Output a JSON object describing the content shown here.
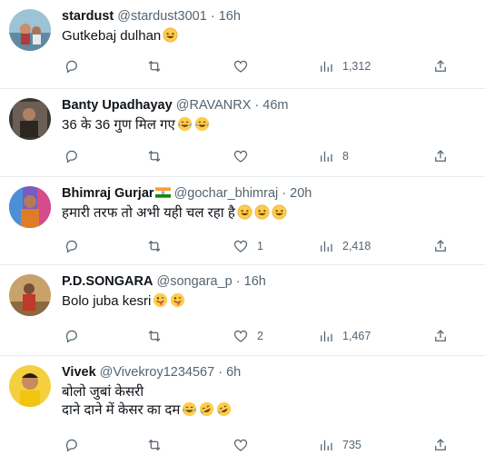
{
  "tweets": [
    {
      "name": "stardust",
      "handle": "@stardust3001",
      "sep": "·",
      "time": "16h",
      "lines": [
        "Gutkebaj dulhan"
      ],
      "replies": "",
      "retweets": "",
      "likes": "",
      "views": "1,312"
    },
    {
      "name": "Banty Upadhayay",
      "handle": "@RAVANRX",
      "sep": "·",
      "time": "46m",
      "lines": [
        "36 के 36 गुण मिल गए"
      ],
      "replies": "",
      "retweets": "",
      "likes": "",
      "views": "8"
    },
    {
      "name": "Bhimraj Gurjar",
      "handle": "@gochar_bhimraj",
      "sep": "·",
      "time": "20h",
      "lines": [
        "हमारी तरफ तो अभी यही चल रहा है"
      ],
      "replies": "",
      "retweets": "",
      "likes": "1",
      "views": "2,418"
    },
    {
      "name": "P.D.SONGARA",
      "handle": "@songara_p",
      "sep": "·",
      "time": "16h",
      "lines": [
        "Bolo juba kesri"
      ],
      "replies": "",
      "retweets": "",
      "likes": "2",
      "views": "1,467"
    },
    {
      "name": "Vivek",
      "handle": "@Vivekroy1234567",
      "sep": "·",
      "time": "6h",
      "lines": [
        "बोलो जुबां केसरी",
        "दाने दाने में केसर का दम"
      ],
      "replies": "",
      "retweets": "",
      "likes": "",
      "views": "735"
    }
  ],
  "icons": {
    "reply": "reply-icon",
    "retweet": "retweet-icon",
    "like": "like-icon",
    "views": "views-icon",
    "share": "share-icon"
  },
  "colors": {
    "text": "#0f1419",
    "secondary": "#536471",
    "divider": "#e7e9ea"
  }
}
